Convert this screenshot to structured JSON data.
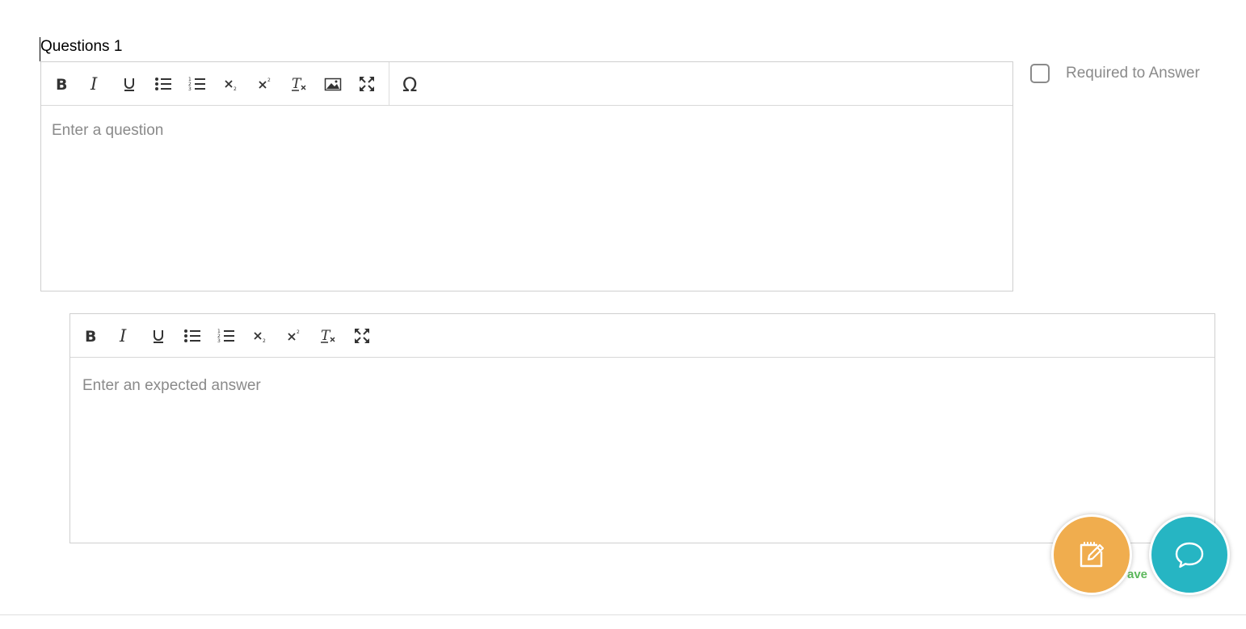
{
  "question": {
    "label": "Questions 1",
    "placeholder": "Enter a question",
    "toolbar": [
      "bold-icon",
      "italic-icon",
      "underline-icon",
      "bulleted-list-icon",
      "numbered-list-icon",
      "subscript-icon",
      "superscript-icon",
      "remove-format-icon",
      "image-icon",
      "maximize-icon",
      "special-character-icon"
    ]
  },
  "required": {
    "label": "Required to Answer",
    "checked": false
  },
  "answer": {
    "placeholder": "Enter an expected answer",
    "toolbar": [
      "bold-icon",
      "italic-icon",
      "underline-icon",
      "bulleted-list-icon",
      "numbered-list-icon",
      "subscript-icon",
      "superscript-icon",
      "remove-format-icon",
      "maximize-icon"
    ]
  },
  "save": {
    "label": "ave"
  },
  "colors": {
    "note_button": "#f0ad4e",
    "chat_button": "#26b5c3",
    "save_text": "#5cb85c",
    "icon": "#333333",
    "placeholder": "#8a8a8a"
  }
}
